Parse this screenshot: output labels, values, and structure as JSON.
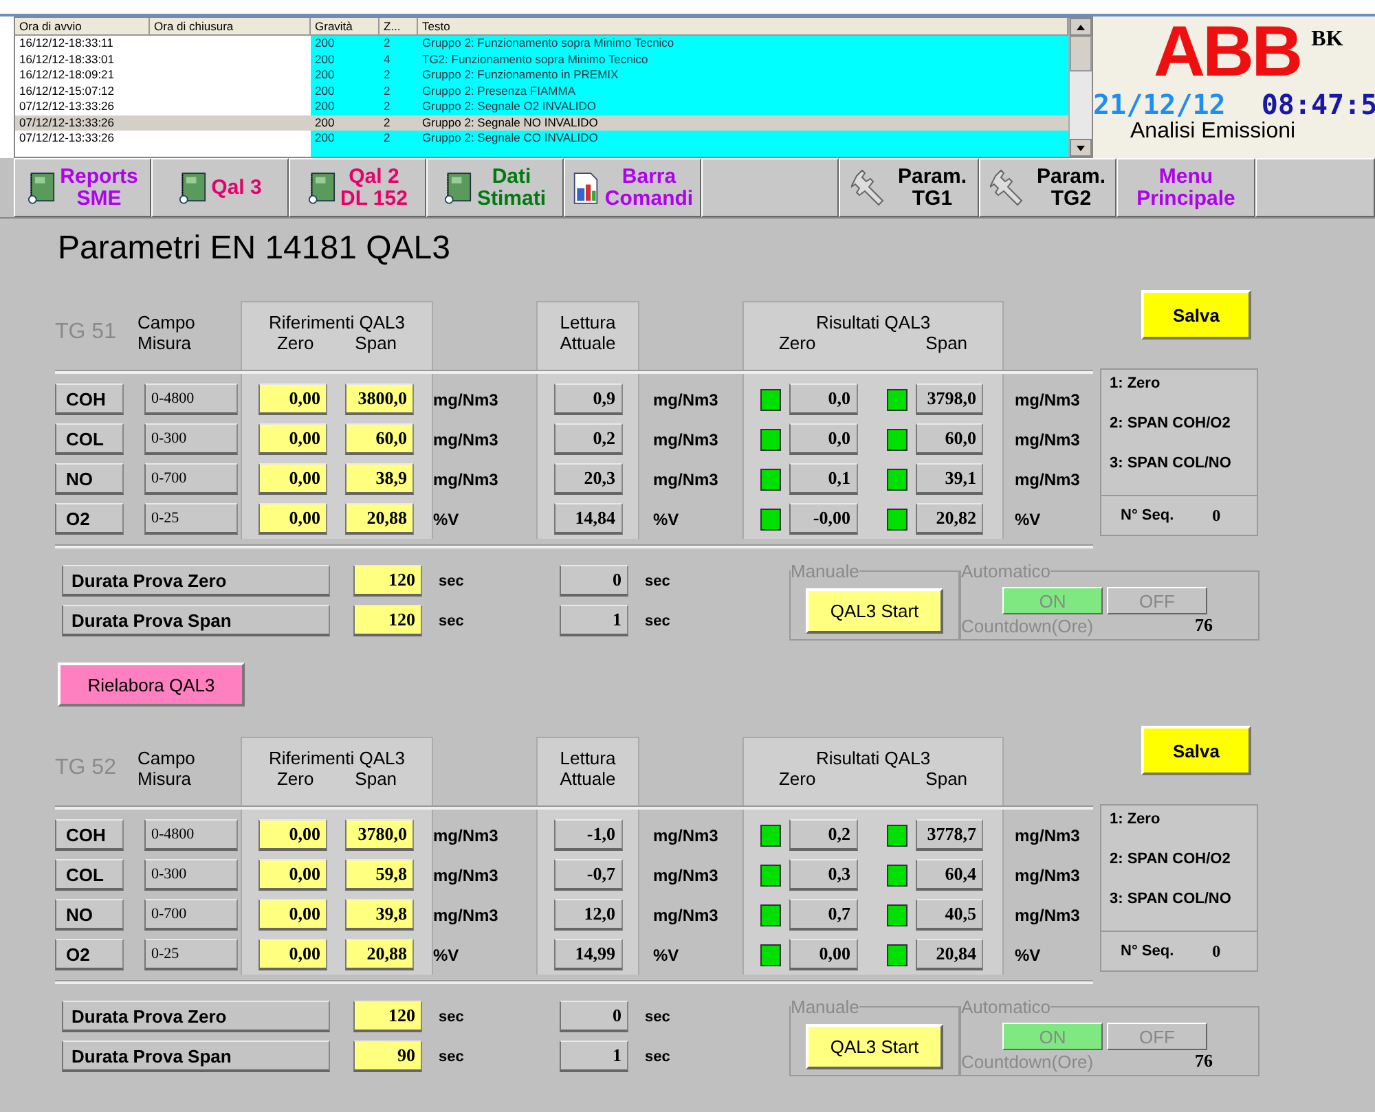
{
  "alarm_table": {
    "columns": [
      "Ora di avvio",
      "Ora di chiusura",
      "Gravità",
      "Z...",
      "Testo"
    ],
    "rows": [
      {
        "start": "16/12/12-18:33:11",
        "severity": "200",
        "zone": "2",
        "text": "Gruppo 2: Funzionamento sopra Minimo Tecnico",
        "selected": false
      },
      {
        "start": "16/12/12-18:33:01",
        "severity": "200",
        "zone": "4",
        "text": "TG2: Funzionamento sopra Minimo Tecnico",
        "selected": false
      },
      {
        "start": "16/12/12-18:09:21",
        "severity": "200",
        "zone": "2",
        "text": "Gruppo 2: Funzionamento in PREMIX",
        "selected": false
      },
      {
        "start": "16/12/12-15:07:12",
        "severity": "200",
        "zone": "2",
        "text": "Gruppo 2: Presenza FIAMMA",
        "selected": false
      },
      {
        "start": "07/12/12-13:33:26",
        "severity": "200",
        "zone": "2",
        "text": "Gruppo 2: Segnale O2 INVALIDO",
        "selected": false
      },
      {
        "start": "07/12/12-13:33:26",
        "severity": "200",
        "zone": "2",
        "text": "Gruppo 2: Segnale NO INVALIDO",
        "selected": true
      },
      {
        "start": "07/12/12-13:33:26",
        "severity": "200",
        "zone": "2",
        "text": "Gruppo 2: Segnale CO INVALIDO",
        "selected": false
      }
    ]
  },
  "brand": {
    "logo": "ABB",
    "suffix": "BK",
    "date": "21/12/12",
    "time": "08:47:5",
    "subtitle": "Analisi Emissioni"
  },
  "nav": [
    {
      "lines": [
        "Reports",
        "SME"
      ],
      "kind": "panel",
      "color": "#b000f0"
    },
    {
      "lines": [
        "Qal 3"
      ],
      "kind": "panel",
      "color": "#e8006a"
    },
    {
      "lines": [
        "Qal 2",
        "DL 152"
      ],
      "kind": "panel",
      "color": "#e8006a"
    },
    {
      "lines": [
        "Dati",
        "Stimati"
      ],
      "kind": "panel",
      "color": "#007a10"
    },
    {
      "lines": [
        "Barra",
        "Comandi"
      ],
      "kind": "document",
      "color": "#b000f0"
    },
    {
      "kind": "blank"
    },
    {
      "lines": [
        "Param.",
        "TG1"
      ],
      "kind": "wrench",
      "color": "#000000"
    },
    {
      "lines": [
        "Param.",
        "TG2"
      ],
      "kind": "wrench",
      "color": "#000000"
    },
    {
      "lines": [
        "Menu",
        "Principale"
      ],
      "kind": "text",
      "color": "#b000f0"
    },
    {
      "kind": "blank"
    }
  ],
  "page_title": "Parametri EN 14181 QAL3",
  "sections": [
    {
      "tag": "TG 51",
      "campo": [
        "Campo",
        "Misura"
      ],
      "ref_title": "Riferimenti QAL3",
      "ref_zero": "Zero",
      "ref_span": "Span",
      "reading_title": [
        "Lettura",
        "Attuale"
      ],
      "res_title": "Risultati QAL3",
      "res_zero": "Zero",
      "res_span": "Span",
      "save": "Salva",
      "rows": [
        {
          "name": "COH",
          "range": "0-4800",
          "zero": "0,00",
          "span": "3800,0",
          "unit_ref": "mg/Nm3",
          "reading": "0,9",
          "unit_reading": "mg/Nm3",
          "zero_ok": true,
          "res_zero": "0,0",
          "span_ok": true,
          "res_span": "3798,0",
          "unit_res": "mg/Nm3"
        },
        {
          "name": "COL",
          "range": "0-300",
          "zero": "0,00",
          "span": "60,0",
          "unit_ref": "mg/Nm3",
          "reading": "0,2",
          "unit_reading": "mg/Nm3",
          "zero_ok": true,
          "res_zero": "0,0",
          "span_ok": true,
          "res_span": "60,0",
          "unit_res": "mg/Nm3"
        },
        {
          "name": "NO",
          "range": "0-700",
          "zero": "0,00",
          "span": "38,9",
          "unit_ref": "mg/Nm3",
          "reading": "20,3",
          "unit_reading": "mg/Nm3",
          "zero_ok": true,
          "res_zero": "0,1",
          "span_ok": true,
          "res_span": "39,1",
          "unit_res": "mg/Nm3"
        },
        {
          "name": "O2",
          "range": "0-25",
          "zero": "0,00",
          "span": "20,88",
          "unit_ref": "%V",
          "reading": "14,84",
          "unit_reading": "%V",
          "zero_ok": true,
          "res_zero": "-0,00",
          "span_ok": true,
          "res_span": "20,82",
          "unit_res": "%V"
        }
      ],
      "info": [
        "1: Zero",
        "2: SPAN COH/O2",
        "3: SPAN COL/NO"
      ],
      "seq_label": "N° Seq.",
      "seq": "0",
      "durations": [
        {
          "label": "Durata Prova Zero",
          "value": "120",
          "unit": "sec",
          "reading": "0",
          "reading_unit": "sec"
        },
        {
          "label": "Durata Prova Span",
          "value": "120",
          "unit": "sec",
          "reading": "1",
          "reading_unit": "sec"
        }
      ],
      "manual_label": "Manuale",
      "start": "QAL3 Start",
      "auto_label": "Automatico",
      "on": "ON",
      "off": "OFF",
      "auto_on": true,
      "countdown_label": "Countdown(Ore)",
      "countdown": "76"
    },
    {
      "tag": "TG 52",
      "campo": [
        "Campo",
        "Misura"
      ],
      "ref_title": "Riferimenti QAL3",
      "ref_zero": "Zero",
      "ref_span": "Span",
      "reading_title": [
        "Lettura",
        "Attuale"
      ],
      "res_title": "Risultati QAL3",
      "res_zero": "Zero",
      "res_span": "Span",
      "save": "Salva",
      "rows": [
        {
          "name": "COH",
          "range": "0-4800",
          "zero": "0,00",
          "span": "3780,0",
          "unit_ref": "mg/Nm3",
          "reading": "-1,0",
          "unit_reading": "mg/Nm3",
          "zero_ok": true,
          "res_zero": "0,2",
          "span_ok": true,
          "res_span": "3778,7",
          "unit_res": "mg/Nm3"
        },
        {
          "name": "COL",
          "range": "0-300",
          "zero": "0,00",
          "span": "59,8",
          "unit_ref": "mg/Nm3",
          "reading": "-0,7",
          "unit_reading": "mg/Nm3",
          "zero_ok": true,
          "res_zero": "0,3",
          "span_ok": true,
          "res_span": "60,4",
          "unit_res": "mg/Nm3"
        },
        {
          "name": "NO",
          "range": "0-700",
          "zero": "0,00",
          "span": "39,8",
          "unit_ref": "mg/Nm3",
          "reading": "12,0",
          "unit_reading": "mg/Nm3",
          "zero_ok": true,
          "res_zero": "0,7",
          "span_ok": true,
          "res_span": "40,5",
          "unit_res": "mg/Nm3"
        },
        {
          "name": "O2",
          "range": "0-25",
          "zero": "0,00",
          "span": "20,88",
          "unit_ref": "%V",
          "reading": "14,99",
          "unit_reading": "%V",
          "zero_ok": true,
          "res_zero": "0,00",
          "span_ok": true,
          "res_span": "20,84",
          "unit_res": "%V"
        }
      ],
      "info": [
        "1: Zero",
        "2: SPAN COH/O2",
        "3: SPAN COL/NO"
      ],
      "seq_label": "N° Seq.",
      "seq": "0",
      "durations": [
        {
          "label": "Durata Prova Zero",
          "value": "120",
          "unit": "sec",
          "reading": "0",
          "reading_unit": "sec"
        },
        {
          "label": "Durata Prova Span",
          "value": "90",
          "unit": "sec",
          "reading": "1",
          "reading_unit": "sec"
        }
      ],
      "manual_label": "Manuale",
      "start": "QAL3 Start",
      "auto_label": "Automatico",
      "on": "ON",
      "off": "OFF",
      "auto_on": true,
      "countdown_label": "Countdown(Ore)",
      "countdown": "76"
    }
  ],
  "rework_button": "Rielabora QAL3"
}
